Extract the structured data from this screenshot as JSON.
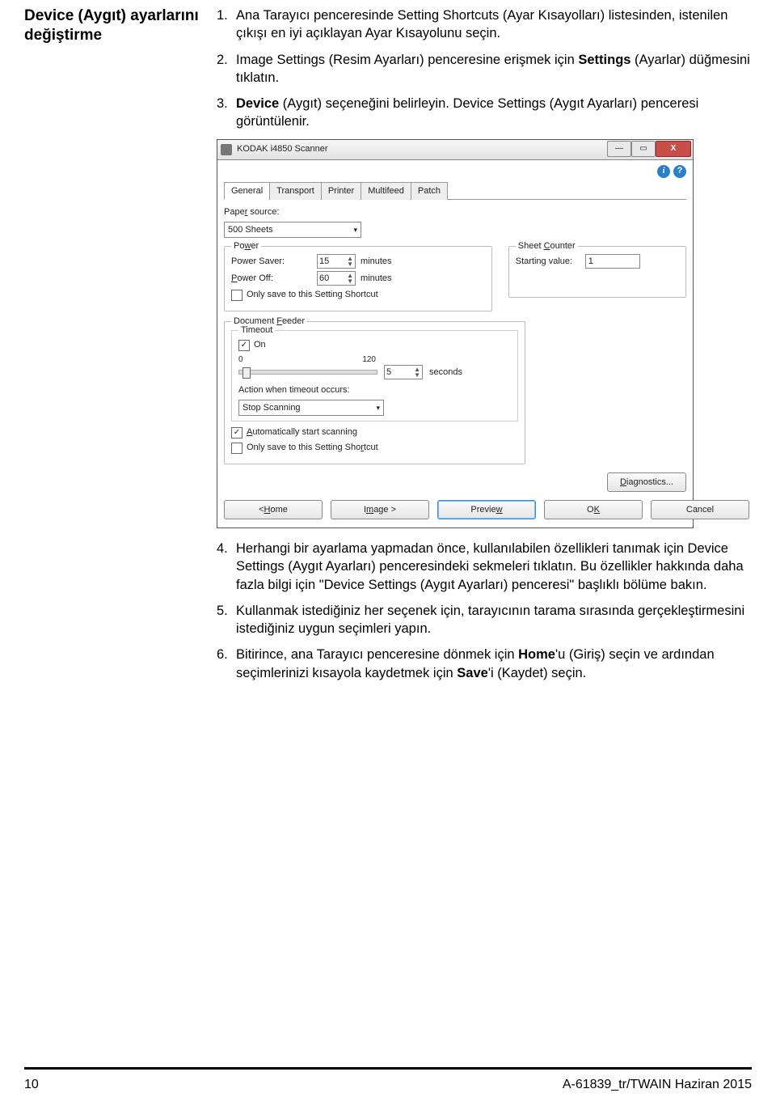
{
  "page_heading": "Device (Aygıt) ayarlarını değiştirme",
  "steps": {
    "s1": {
      "num": "1.",
      "text": "Ana Tarayıcı penceresinde Setting Shortcuts (Ayar Kısayolları) listesinden, istenilen çıkışı en iyi açıklayan Ayar Kısayolunu seçin."
    },
    "s2": {
      "num": "2.",
      "pre": "Image Settings (Resim Ayarları) penceresine erişmek için ",
      "bold": "Settings",
      "post": " (Ayarlar) düğmesini tıklatın."
    },
    "s3": {
      "num": "3.",
      "bold": "Device",
      "post": " (Aygıt) seçeneğini belirleyin. Device Settings (Aygıt Ayarları) penceresi görüntülenir."
    },
    "s4": {
      "num": "4.",
      "text": "Herhangi bir ayarlama yapmadan önce, kullanılabilen özellikleri tanımak için Device Settings (Aygıt Ayarları) penceresindeki sekmeleri tıklatın. Bu özellikler hakkında daha fazla bilgi için \"Device Settings (Aygıt Ayarları) penceresi\" başlıklı bölüme bakın."
    },
    "s5": {
      "num": "5.",
      "text": "Kullanmak istediğiniz her seçenek için, tarayıcının tarama sırasında gerçekleştirmesini istediğiniz uygun seçimleri yapın."
    },
    "s6": {
      "num": "6.",
      "pre": "Bitirince, ana Tarayıcı penceresine dönmek için ",
      "b1": "Home",
      "mid": "'u (Giriş) seçin ve ardından seçimlerinizi kısayola kaydetmek için ",
      "b2": "Save",
      "post2": "'i (Kaydet) seçin."
    }
  },
  "window": {
    "title": "KODAK i4850 Scanner",
    "tabs": {
      "general": "General",
      "transport": "Transport",
      "printer": "Printer",
      "multifeed": "Multifeed",
      "patch": "Patch"
    },
    "paper_source_label": "Paper source:",
    "paper_source_value": "500 Sheets",
    "power_group": "Power",
    "power_saver_label": "Power Saver:",
    "power_saver_value": "15",
    "power_off_label": "Power Off:",
    "power_off_value": "60",
    "minutes": "minutes",
    "only_save": "Only save to this Setting Shortcut",
    "sheet_counter_group": "Sheet Counter",
    "starting_value_label": "Starting value:",
    "starting_value_value": "1",
    "doc_feeder_group": "Document Feeder",
    "timeout_group": "Timeout",
    "on_label": "On",
    "slider_min": "0",
    "slider_max": "120",
    "timeout_value": "5",
    "seconds": "seconds",
    "action_label": "Action when timeout occurs:",
    "action_value": "Stop Scanning",
    "auto_start": "Automatically start scanning",
    "diagnostics": "Diagnostics...",
    "btn_home": "< Home",
    "btn_image": "Image >",
    "btn_preview": "Preview",
    "btn_ok": "OK",
    "btn_cancel": "Cancel"
  },
  "footer": {
    "pagenum": "10",
    "docref": "A-61839_tr/TWAIN  Haziran 2015"
  }
}
